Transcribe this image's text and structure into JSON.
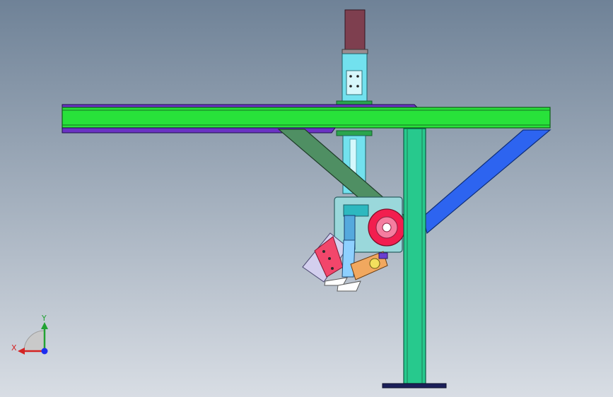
{
  "viewport": {
    "background_top": "#6f8297",
    "background_bottom": "#d8dde4"
  },
  "colors": {
    "beam_green": "#28e23a",
    "beam_outline": "#0f5f18",
    "beam_purple": "#6b32c4",
    "column_teal": "#27c98d",
    "column_outline": "#0b5b45",
    "diagonal_green": "#4f8f63",
    "diagonal_blue": "#2d64f0",
    "slider_cyan": "#72e1ee",
    "motor_maroon": "#7e3f4f",
    "gripper_red": "#f2466b",
    "gripper_light": "#d3cfee",
    "wheel_red": "#f21e4f",
    "base_navy": "#1b1f5a"
  },
  "triad": {
    "x_label": "X",
    "y_label": "Y"
  }
}
